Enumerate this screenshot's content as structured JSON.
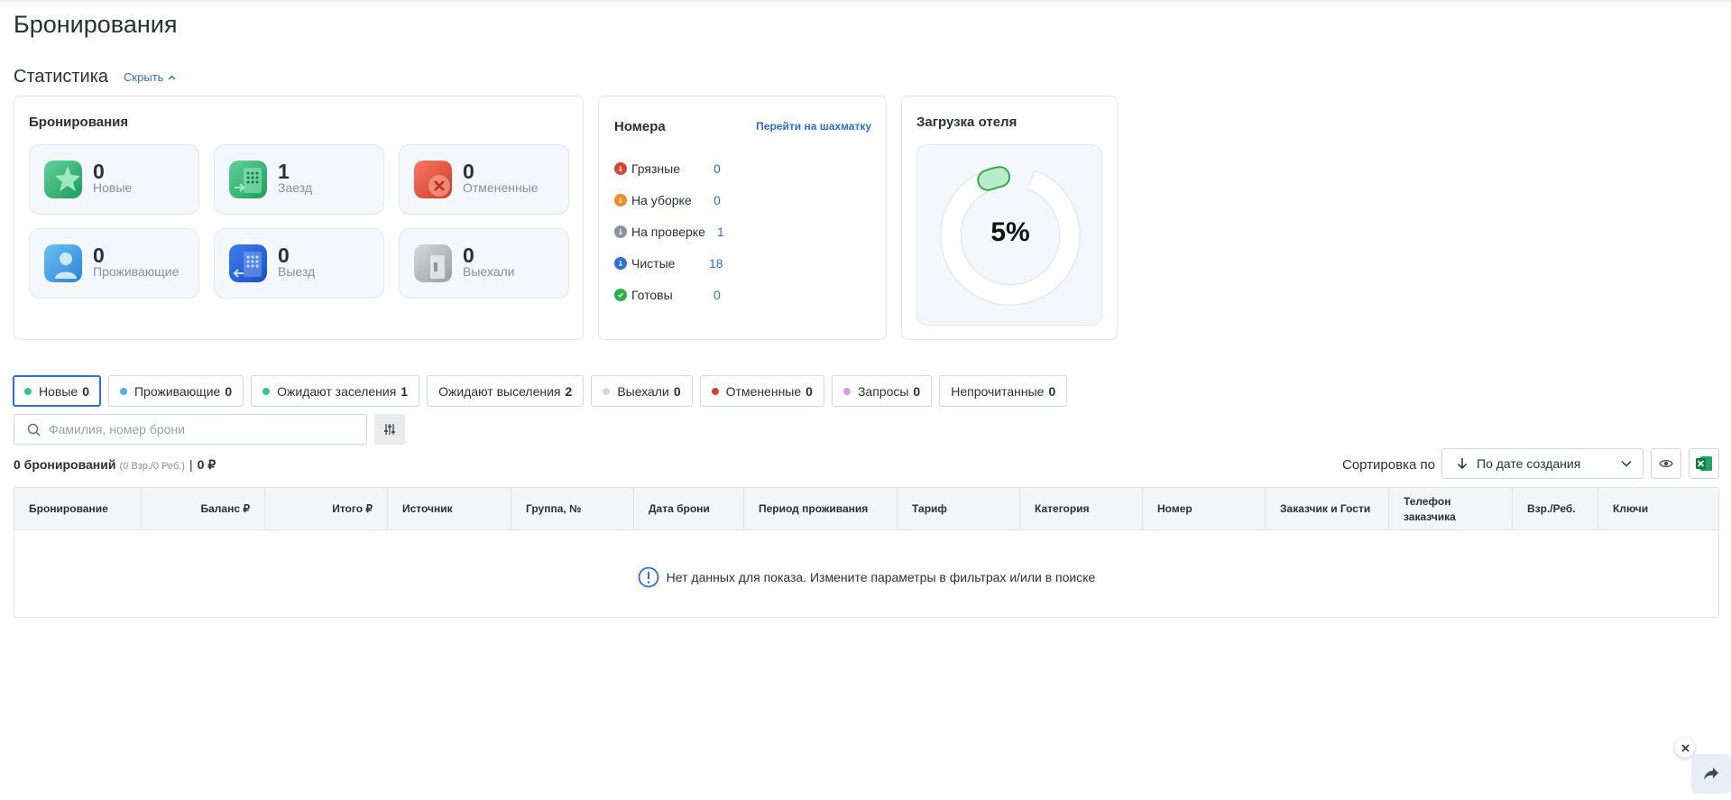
{
  "page": {
    "title": "Бронирования"
  },
  "stats": {
    "title": "Статистика",
    "hide_label": "Скрыть"
  },
  "bookings": {
    "title": "Бронирования",
    "tiles": [
      {
        "value": "0",
        "label": "Новые",
        "icon": "star-icon"
      },
      {
        "value": "1",
        "label": "Заезд",
        "icon": "check-in-door-icon"
      },
      {
        "value": "0",
        "label": "Отмененные",
        "icon": "cancel-icon"
      },
      {
        "value": "0",
        "label": "Проживающие",
        "icon": "guest-icon"
      },
      {
        "value": "0",
        "label": "Выезд",
        "icon": "check-out-door-icon"
      },
      {
        "value": "0",
        "label": "Выехали",
        "icon": "door-closed-icon"
      }
    ]
  },
  "rooms": {
    "title": "Номера",
    "chess_link": "Перейти на шахматку",
    "rows": [
      {
        "label": "Грязные",
        "value": "0",
        "color": "#d9432f"
      },
      {
        "label": "На уборке",
        "value": "0",
        "color": "#f08a24"
      },
      {
        "label": "На проверке",
        "value": "1",
        "color": "#8c929c"
      },
      {
        "label": "Чистые",
        "value": "18",
        "color": "#2f6fd6"
      },
      {
        "label": "Готовы",
        "value": "0",
        "color": "#2fae4e"
      }
    ]
  },
  "load": {
    "title": "Загрузка отеля",
    "percent_text": "5%",
    "percent": 5
  },
  "filters": [
    {
      "label": "Новые",
      "count": "0",
      "dot": "#3cc48a",
      "active": true
    },
    {
      "label": "Проживающие",
      "count": "0",
      "dot": "#5aaee8"
    },
    {
      "label": "Ожидают заселения",
      "count": "1",
      "dot": "#3cc48a"
    },
    {
      "label": "Ожидают выселения",
      "count": "2",
      "dot": ""
    },
    {
      "label": "Выехали",
      "count": "0",
      "dot": "#d3d6db"
    },
    {
      "label": "Отмененные",
      "count": "0",
      "dot": "#d9432f"
    },
    {
      "label": "Запросы",
      "count": "0",
      "dot": "#d79be8"
    },
    {
      "label": "Непрочитанные",
      "count": "0",
      "dot": ""
    }
  ],
  "search": {
    "placeholder": "Фамилия, номер брони"
  },
  "summary": {
    "count_text": "0 бронирований",
    "guests_text": "(0 Взр./0 Реб.)",
    "sep": "|",
    "total": "0 ₽"
  },
  "sort": {
    "label": "Сортировка по",
    "value": "По дате создания"
  },
  "table": {
    "columns": [
      "Бронирование",
      "Баланс ₽",
      "Итого ₽",
      "Источник",
      "Группа, №",
      "Дата брони",
      "Период проживания",
      "Тариф",
      "Категория",
      "Номер",
      "Заказчик и Гости",
      "Телефон заказчика",
      "Взр./Реб.",
      "Ключи"
    ],
    "empty_text": "Нет данных для показа. Измените параметры в фильтрах и/или в поиске"
  },
  "colors": {
    "accent": "#2f6fd6",
    "tile_bg": "#f4f7fb"
  }
}
